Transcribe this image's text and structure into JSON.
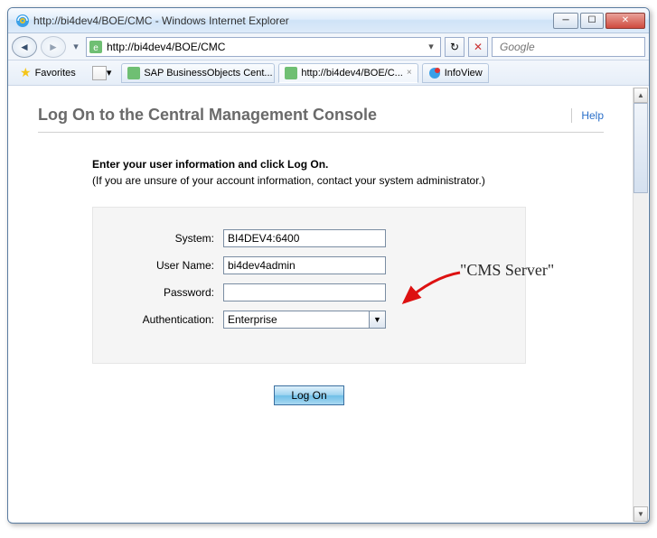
{
  "window": {
    "title": "http://bi4dev4/BOE/CMC - Windows Internet Explorer",
    "min_tip": "Minimize",
    "max_tip": "Maximize",
    "close_tip": "Close"
  },
  "nav": {
    "back_tip": "Back",
    "fwd_tip": "Forward",
    "address": "http://bi4dev4/BOE/CMC",
    "refresh_tip": "Refresh",
    "stop_tip": "Stop",
    "search_placeholder": "Google"
  },
  "favbar": {
    "favorites": "Favorites"
  },
  "tabs": [
    {
      "label": "SAP BusinessObjects Cent...",
      "active": false,
      "close": "×"
    },
    {
      "label": "http://bi4dev4/BOE/C...",
      "active": true,
      "close": "×"
    },
    {
      "label": "InfoView",
      "active": false,
      "close": ""
    }
  ],
  "page": {
    "title": "Log On to the Central Management Console",
    "help": "Help",
    "intro_bold": "Enter your user information and click Log On.",
    "intro_rest": "(If you are unsure of your account information, contact your system administrator.)",
    "labels": {
      "system": "System:",
      "username": "User Name:",
      "password": "Password:",
      "auth": "Authentication:"
    },
    "values": {
      "system": "BI4DEV4:6400",
      "username": "bi4dev4admin",
      "password": "",
      "auth": "Enterprise"
    },
    "logon_btn": "Log On"
  },
  "annotation": {
    "text": "\"CMS Server\""
  }
}
